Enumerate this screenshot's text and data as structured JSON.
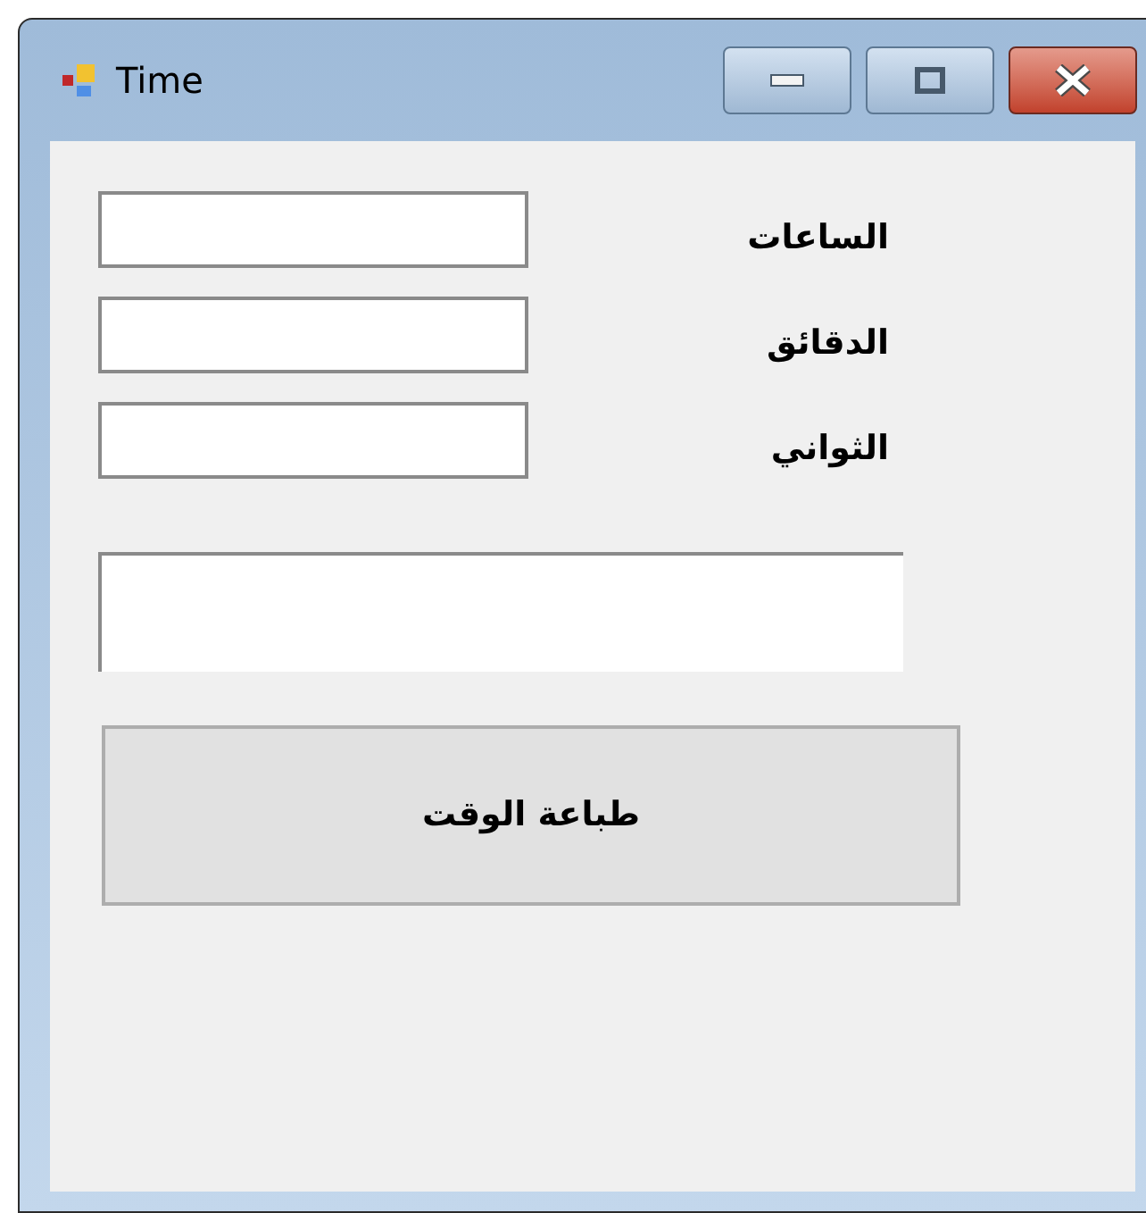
{
  "window": {
    "title": "Time"
  },
  "fields": [
    {
      "label": "الساعات"
    },
    {
      "label": "الدقائق"
    },
    {
      "label": "الثواني"
    }
  ],
  "button": {
    "label": "طباعة الوقت"
  }
}
